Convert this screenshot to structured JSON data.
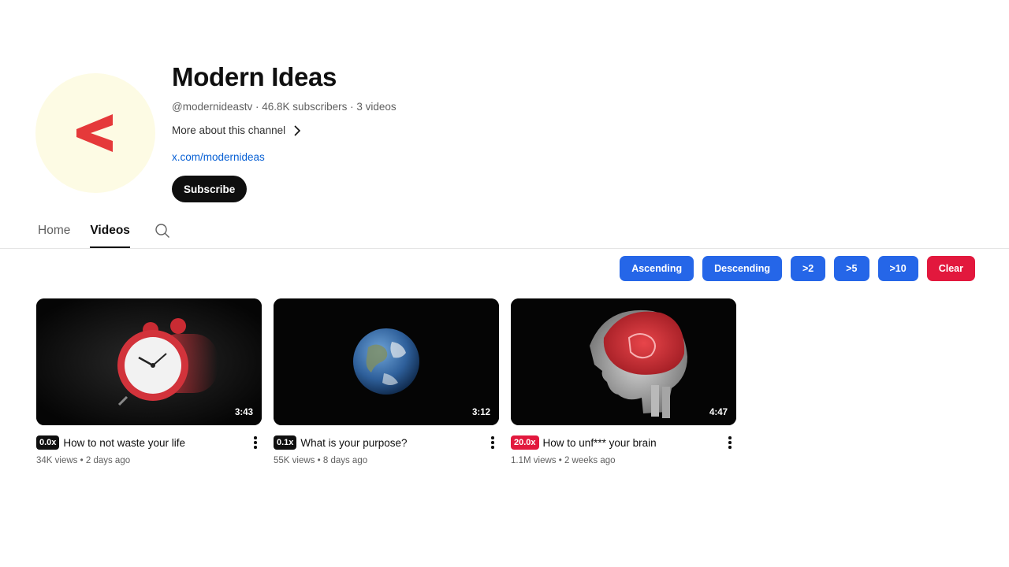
{
  "channel": {
    "name": "Modern Ideas",
    "handle": "@modernideastv",
    "subscribers": "46.8K subscribers",
    "video_count": "3 videos",
    "more_about": "More about this channel",
    "link": "x.com/modernideas",
    "subscribe_label": "Subscribe",
    "avatar_icon": "less-than-logo",
    "avatar_color": "#e5393a",
    "avatar_bg": "#fdfbe4"
  },
  "tabs": [
    {
      "label": "Home",
      "active": false
    },
    {
      "label": "Videos",
      "active": true
    }
  ],
  "filters": {
    "ascending": "Ascending",
    "descending": "Descending",
    "gt2": ">2",
    "gt5": ">5",
    "gt10": ">10",
    "clear": "Clear",
    "primary_color": "#2566e8",
    "clear_color": "#e2183d"
  },
  "videos": [
    {
      "title": "How to not waste your life",
      "speed": "0.0x",
      "views": "34K views",
      "age": "2 days ago",
      "duration": "3:43",
      "thumbnail_icon": "alarm-clock-icon"
    },
    {
      "title": "What is your purpose?",
      "speed": "0.1x",
      "views": "55K views",
      "age": "8 days ago",
      "duration": "3:12",
      "thumbnail_icon": "earth-icon"
    },
    {
      "title": "How to unf*** your brain",
      "speed": "20.0x",
      "views": "1.1M views",
      "age": "2 weeks ago",
      "duration": "4:47",
      "thumbnail_icon": "brain-xray-icon"
    }
  ]
}
